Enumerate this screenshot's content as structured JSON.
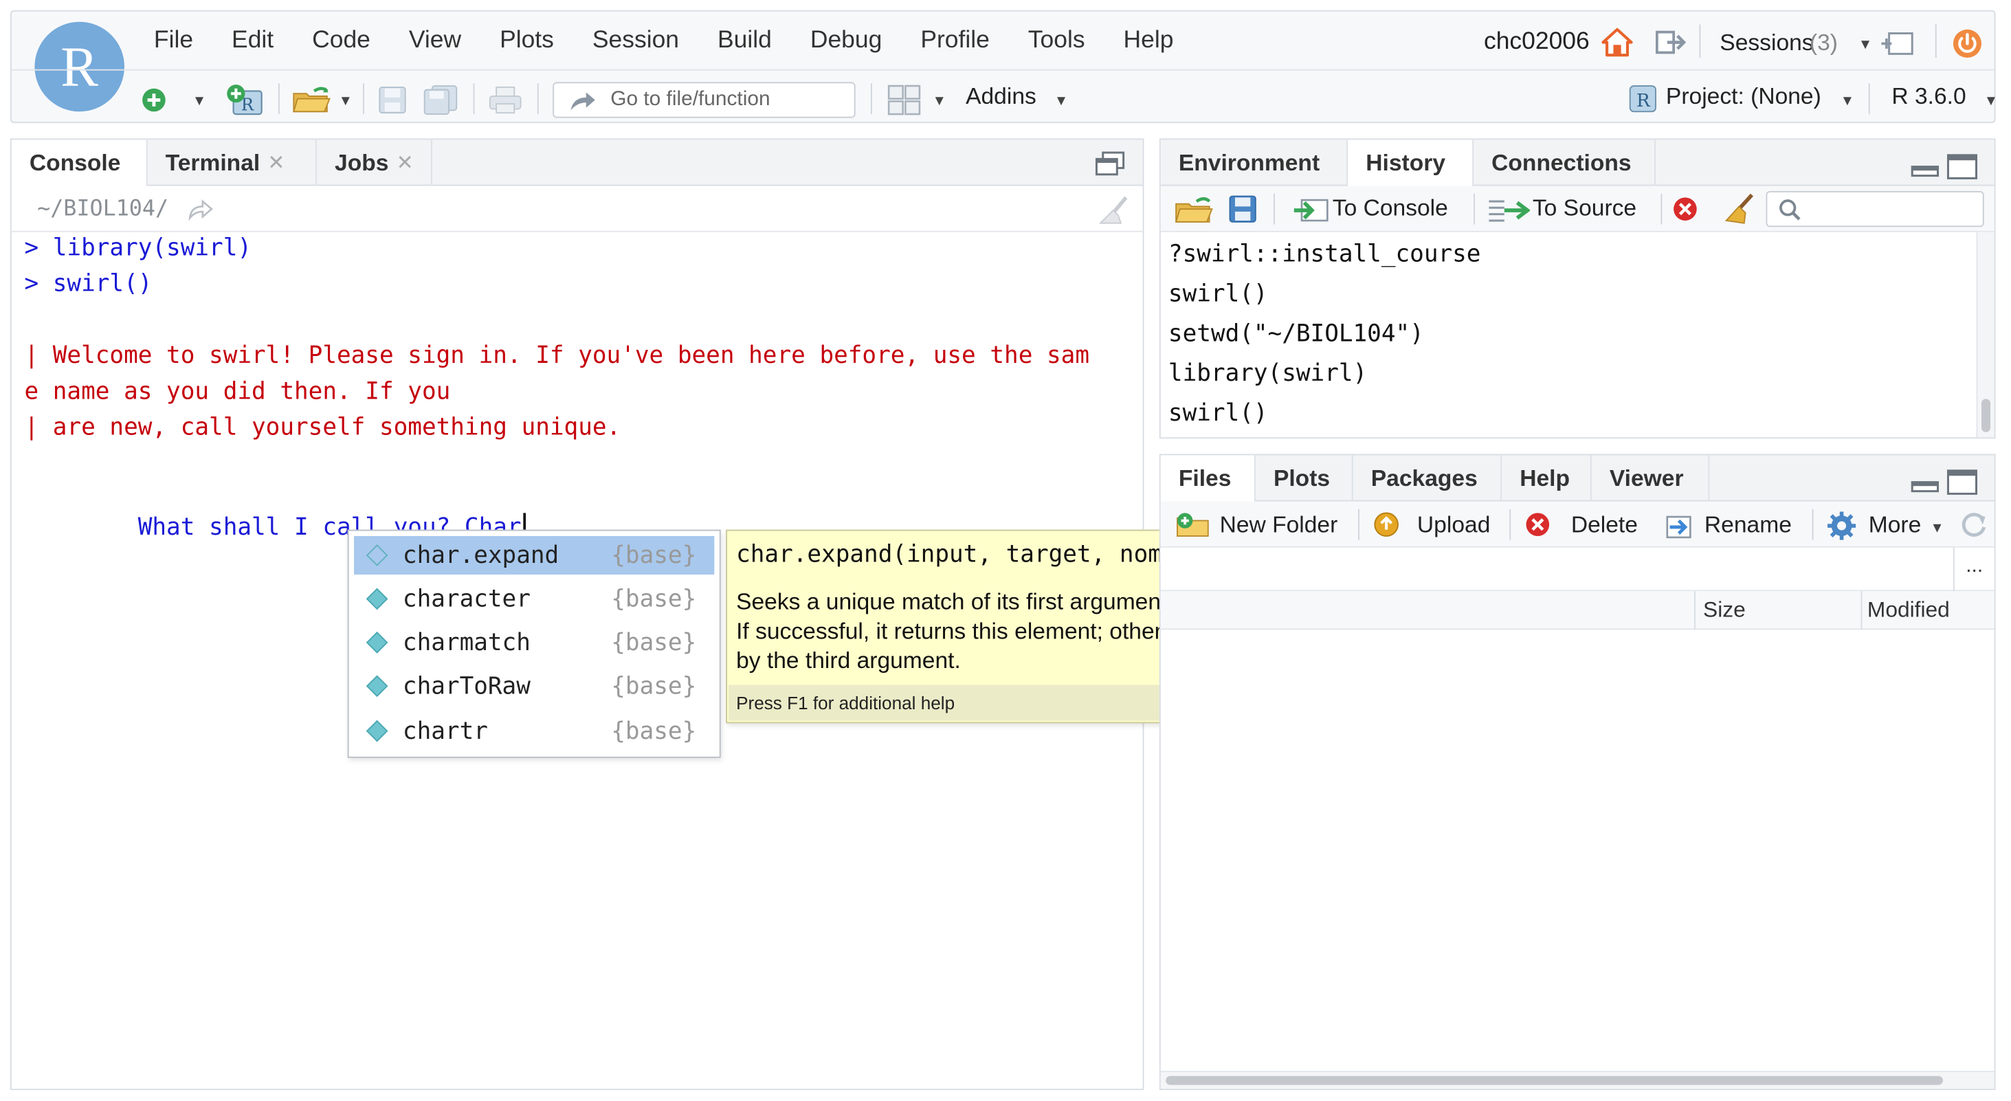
{
  "app": {
    "logo_letter": "R",
    "menu": [
      "File",
      "Edit",
      "Code",
      "View",
      "Plots",
      "Session",
      "Build",
      "Debug",
      "Profile",
      "Tools",
      "Help"
    ],
    "user": "chc02006",
    "sessions_label": "Sessions",
    "sessions_count": "(3)",
    "goto_placeholder": "Go to file/function",
    "addins_label": "Addins",
    "project_label": "Project: (None)",
    "r_version": "R 3.6.0"
  },
  "console": {
    "tabs": [
      {
        "label": "Console",
        "closable": false
      },
      {
        "label": "Terminal",
        "closable": true
      },
      {
        "label": "Jobs",
        "closable": true
      }
    ],
    "path": "~/BIOL104/",
    "lines": [
      {
        "text": "> library(swirl)",
        "color": "blue"
      },
      {
        "text": "> swirl()",
        "color": "blue"
      },
      {
        "text": "| Welcome to swirl! Please sign in. If you've been here before, use the sam",
        "color": "red"
      },
      {
        "text": "e name as you did then. If you",
        "color": "red"
      },
      {
        "text": "| are new, call yourself something unique.",
        "color": "red"
      },
      {
        "text": "What shall I call you? Char",
        "color": "blue"
      }
    ],
    "autocomplete": [
      {
        "name": "char.expand",
        "pkg": "{base}",
        "selected": true
      },
      {
        "name": "character",
        "pkg": "{base}",
        "selected": false
      },
      {
        "name": "charmatch",
        "pkg": "{base}",
        "selected": false
      },
      {
        "name": "charToRaw",
        "pkg": "{base}",
        "selected": false
      },
      {
        "name": "chartr",
        "pkg": "{base}",
        "selected": false
      }
    ],
    "help": {
      "signature": "char.expand(input, target, nomatch = stop(\"no match\"))",
      "description": "Seeks a unique match of its first argument among the elements of its second. If successful, it returns this element; otherwise, it performs an action specified by the third argument.",
      "footer": "Press F1 for additional help"
    }
  },
  "env_pane": {
    "tabs": [
      "Environment",
      "History",
      "Connections"
    ],
    "active_tab": "History",
    "to_console": "To Console",
    "to_source": "To Source",
    "history": [
      "?swirl::install_course",
      "swirl()",
      "setwd(\"~/BIOL104\")",
      "library(swirl)",
      "swirl()"
    ]
  },
  "files_pane": {
    "tabs": [
      "Files",
      "Plots",
      "Packages",
      "Help",
      "Viewer"
    ],
    "active_tab": "Files",
    "new_folder": "New Folder",
    "upload": "Upload",
    "delete": "Delete",
    "rename": "Rename",
    "more": "More",
    "ellipsis": "...",
    "columns": {
      "size": "Size",
      "modified": "Modified"
    }
  },
  "colors": {
    "logo": "#75aadb",
    "console_blue": "#1a1ad6",
    "console_red": "#c5000b",
    "selection": "#a8c8ed",
    "tooltip_bg": "#ffffcc"
  }
}
